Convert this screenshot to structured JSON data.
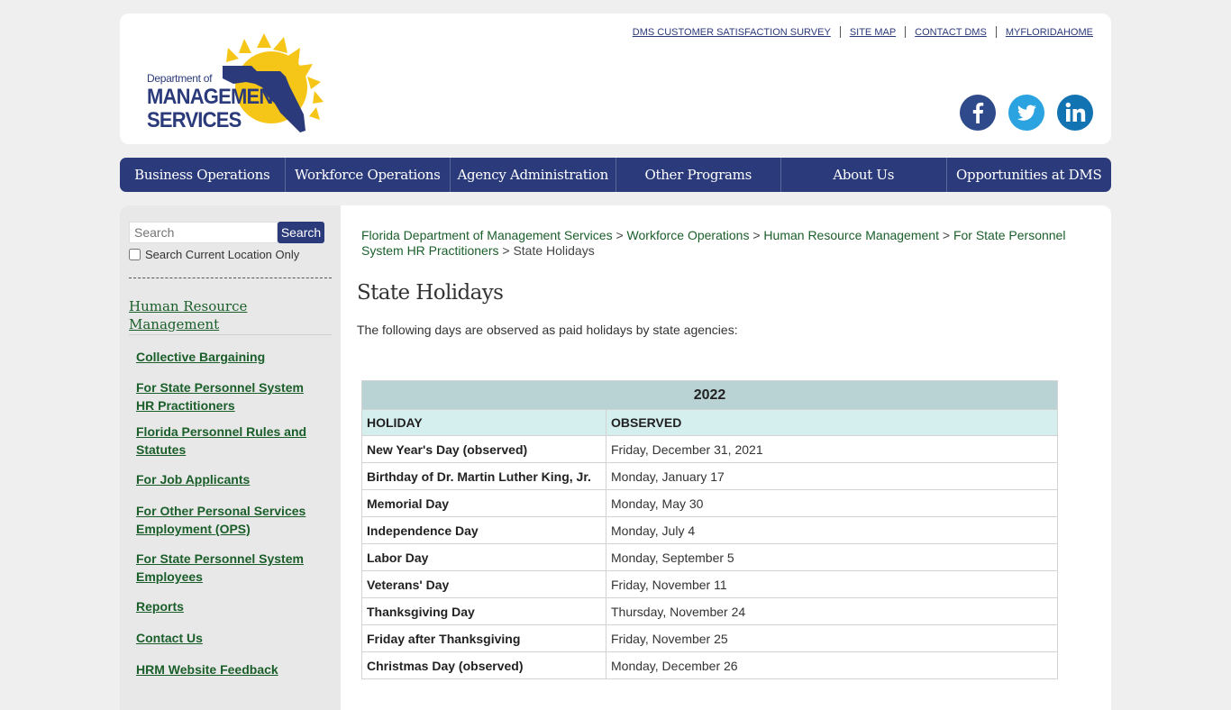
{
  "logo": {
    "line1": "Department of",
    "line2": "MANAGEMENT",
    "line3": "SERVICES"
  },
  "utility_links": [
    "DMS CUSTOMER SATISFACTION SURVEY",
    "SITE MAP",
    "CONTACT DMS",
    "MYFLORIDAHOME"
  ],
  "social": [
    "facebook-icon",
    "twitter-icon",
    "linkedin-icon"
  ],
  "nav": [
    "Business Operations",
    "Workforce Operations",
    "Agency Administration",
    "Other Programs",
    "About Us",
    "Opportunities at DMS"
  ],
  "search": {
    "placeholder": "Search",
    "button": "Search",
    "checkbox_label": "Search Current Location Only"
  },
  "sidebar": {
    "heading": "Human Resource Management",
    "links": [
      "Collective Bargaining",
      "For State Personnel System HR Practitioners",
      "Florida Personnel Rules and Statutes",
      "For Job Applicants",
      "For Other Personal Services Employment (OPS)",
      "For State Personnel System Employees",
      "Reports",
      "Contact Us",
      "HRM Website Feedback"
    ]
  },
  "breadcrumb": {
    "links": [
      "Florida Department of Management Services",
      "Workforce Operations",
      "Human Resource Management",
      "For State Personnel System HR Practitioners"
    ],
    "separator": ">",
    "current": "State Holidays"
  },
  "page": {
    "title": "State Holidays",
    "intro": "The following days are observed as paid holidays by state agencies:"
  },
  "table": {
    "year": "2022",
    "headers": [
      "HOLIDAY",
      "OBSERVED"
    ],
    "rows": [
      [
        "New Year's Day (observed)",
        "Friday, December 31, 2021"
      ],
      [
        "Birthday of Dr. Martin Luther King, Jr.",
        "Monday, January 17"
      ],
      [
        "Memorial Day",
        "Monday, May 30"
      ],
      [
        "Independence Day",
        "Monday, July 4"
      ],
      [
        "Labor Day",
        "Monday, September 5"
      ],
      [
        "Veterans' Day",
        "Friday, November 11"
      ],
      [
        "Thanksgiving Day",
        "Thursday, November 24"
      ],
      [
        "Friday after Thanksgiving",
        "Friday, November 25"
      ],
      [
        "Christmas Day (observed)",
        "Monday, December 26"
      ]
    ]
  },
  "colors": {
    "navy": "#2b3a7a",
    "link_green": "#1a5e2a",
    "sun": "#f5c518",
    "table_year": "#b9d3d5",
    "table_head": "#d5eeee"
  }
}
